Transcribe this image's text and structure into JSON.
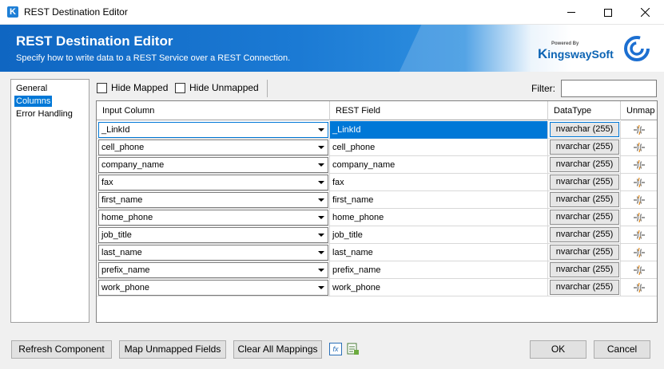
{
  "window": {
    "title": "REST Destination Editor",
    "app_icon": "K"
  },
  "banner": {
    "title": "REST Destination Editor",
    "subtitle": "Specify how to write data to a REST Service over a REST Connection.",
    "logo_powered": "Powered By",
    "logo_k": "K",
    "logo_ingsway": "ingsway",
    "logo_soft": "Soft"
  },
  "nav": {
    "items": [
      {
        "label": "General"
      },
      {
        "label": "Columns",
        "selected": true
      },
      {
        "label": "Error Handling"
      }
    ]
  },
  "toolbar": {
    "hide_mapped": "Hide Mapped",
    "hide_unmapped": "Hide Unmapped",
    "filter_label": "Filter:",
    "filter_value": ""
  },
  "grid": {
    "headers": {
      "input": "Input Column",
      "rest": "REST Field",
      "dtype": "DataType",
      "unmap": "Unmap"
    },
    "rows": [
      {
        "input": "_LinkId",
        "rest": "_LinkId",
        "dtype": "nvarchar (255)"
      },
      {
        "input": "cell_phone",
        "rest": "cell_phone",
        "dtype": "nvarchar (255)"
      },
      {
        "input": "company_name",
        "rest": "company_name",
        "dtype": "nvarchar (255)"
      },
      {
        "input": "fax",
        "rest": "fax",
        "dtype": "nvarchar (255)"
      },
      {
        "input": "first_name",
        "rest": "first_name",
        "dtype": "nvarchar (255)"
      },
      {
        "input": "home_phone",
        "rest": "home_phone",
        "dtype": "nvarchar (255)"
      },
      {
        "input": "job_title",
        "rest": "job_title",
        "dtype": "nvarchar (255)"
      },
      {
        "input": "last_name",
        "rest": "last_name",
        "dtype": "nvarchar (255)"
      },
      {
        "input": "prefix_name",
        "rest": "prefix_name",
        "dtype": "nvarchar (255)"
      },
      {
        "input": "work_phone",
        "rest": "work_phone",
        "dtype": "nvarchar (255)"
      }
    ]
  },
  "buttons": {
    "refresh": "Refresh Component",
    "map_unmapped": "Map Unmapped Fields",
    "clear_all": "Clear All Mappings",
    "ok": "OK",
    "cancel": "Cancel"
  },
  "icons": {
    "expression": "fx",
    "accent": "#0078d7"
  }
}
